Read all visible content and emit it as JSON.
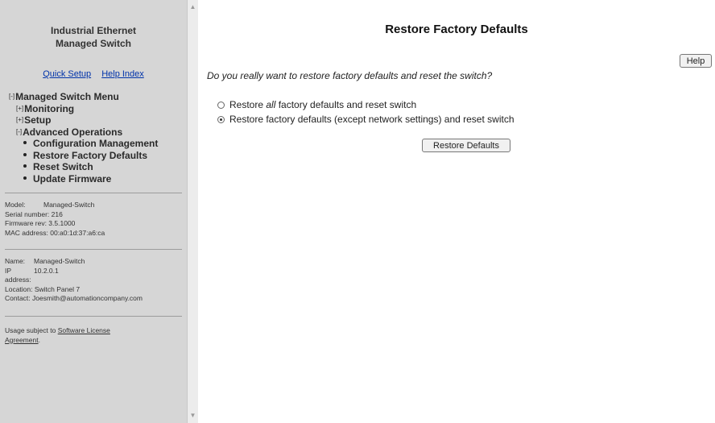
{
  "sidebar": {
    "title_line1": "Industrial Ethernet",
    "title_line2": "Managed Switch",
    "links": {
      "quick_setup": "Quick Setup",
      "help_index": "Help Index"
    },
    "menu": {
      "root": {
        "toggle": "[-]",
        "label": "Managed Switch Menu"
      },
      "monitoring": {
        "toggle": "[+]",
        "label": "Monitoring"
      },
      "setup": {
        "toggle": "[+]",
        "label": "Setup"
      },
      "advanced": {
        "toggle": "[-]",
        "label": "Advanced Operations"
      },
      "items": [
        "Configuration Management",
        "Restore Factory Defaults",
        "Reset Switch",
        "Update Firmware"
      ]
    },
    "device": {
      "model_label": "Model:",
      "model_value": "Managed-Switch",
      "serial": "Serial number: 216",
      "firmware": "Firmware rev: 3.5.1000",
      "mac": "MAC address: 00:a0:1d:37:a6:ca"
    },
    "settings": {
      "name_label": "Name:",
      "name_value": "Managed-Switch",
      "ip_label": "IP",
      "ip_value": "10.2.0.1",
      "address_label": "address:",
      "location": "Location: Switch Panel 7",
      "contact": "Contact: Joesmith@automationcompany.com"
    },
    "usage": {
      "prefix": "Usage subject to ",
      "link_line1": "Software License",
      "link_line2": "Agreement",
      "suffix": "."
    }
  },
  "main": {
    "title": "Restore Factory Defaults",
    "help_label": "Help",
    "question": "Do you really want to restore factory defaults and reset the switch?",
    "option1": {
      "before": "Restore ",
      "em": "all",
      "after": " factory defaults and reset switch",
      "checked": false
    },
    "option2": {
      "label": "Restore factory defaults (except network settings) and reset switch",
      "checked": true
    },
    "restore_button": "Restore Defaults"
  }
}
